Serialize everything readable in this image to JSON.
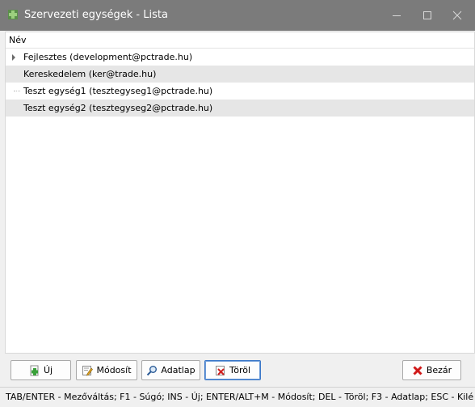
{
  "window": {
    "title": "Szervezeti egységek - Lista",
    "icon": "app-green-icon",
    "controls": {
      "minimize": "minimize-icon",
      "maximize": "maximize-icon",
      "close": "close-icon"
    }
  },
  "tree": {
    "header": "Név",
    "rows": [
      {
        "label": "Fejlesztes (development@pctrade.hu)",
        "expandable": true
      },
      {
        "label": "Kereskedelem (ker@trade.hu)",
        "expandable": false
      },
      {
        "label": "Teszt egység1 (tesztegyseg1@pctrade.hu)",
        "expandable": false
      },
      {
        "label": "Teszt egység2 (tesztegyseg2@pctrade.hu)",
        "expandable": false
      }
    ]
  },
  "buttons": {
    "uj": {
      "label": "Új",
      "icon": "add-icon"
    },
    "modosit": {
      "label": "Módosít",
      "icon": "edit-icon"
    },
    "adatlap": {
      "label": "Adatlap",
      "icon": "magnifier-icon"
    },
    "torol": {
      "label": "Töröl",
      "icon": "delete-icon"
    },
    "bezar": {
      "label": "Bezár",
      "icon": "close-red-icon"
    }
  },
  "statusbar": {
    "text": "TAB/ENTER - Mezőváltás; F1 - Súgó; INS - Új; ENTER/ALT+M - Módosít; DEL - Töröl; F3 - Adatlap; ESC - Kilé"
  },
  "colors": {
    "titlebar": "#7b7b7b",
    "alt_row": "#e6e6e6",
    "focus_border": "#3c78c8"
  }
}
